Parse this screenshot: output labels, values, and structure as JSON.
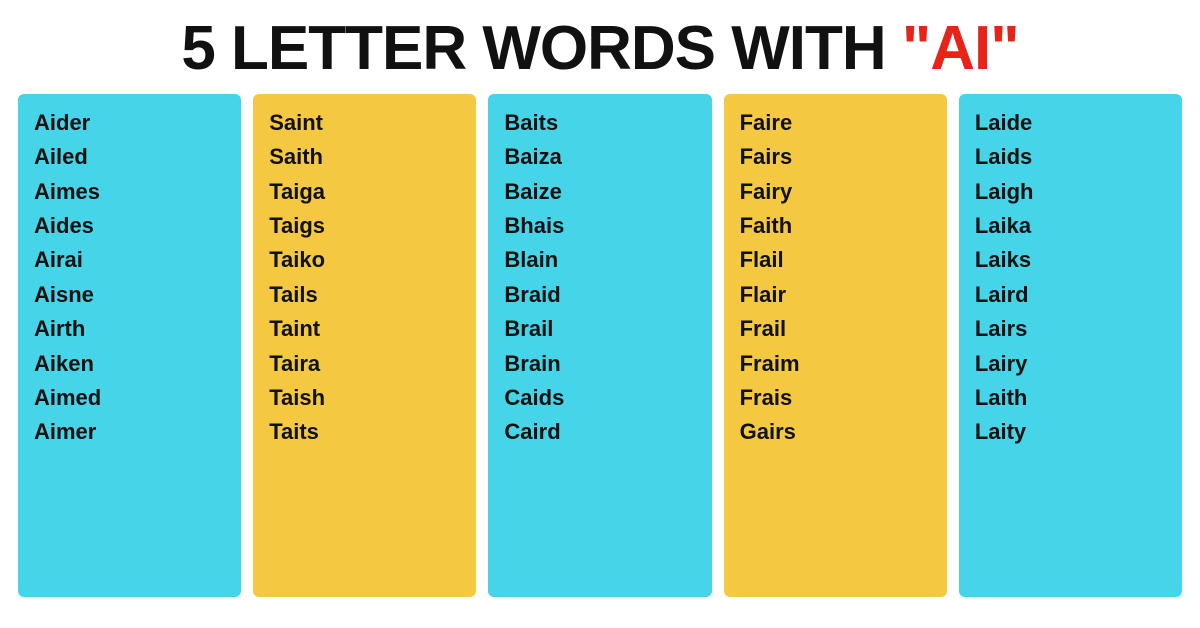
{
  "header": {
    "title_black": "5 LETTER WORDS WITH ",
    "title_red": "\"AI\""
  },
  "colors": {
    "cyan": "#45d4e8",
    "yellow": "#f5c842",
    "red": "#e8231a"
  },
  "columns": [
    {
      "id": "col1",
      "color": "cyan",
      "words": [
        "Aider",
        "Ailed",
        "Aimes",
        "Aides",
        "Airai",
        "Aisne",
        "Airth",
        "Aiken",
        "Aimed",
        "Aimer"
      ]
    },
    {
      "id": "col2",
      "color": "yellow",
      "words": [
        "Saint",
        "Saith",
        "Taiga",
        "Taigs",
        "Taiko",
        "Tails",
        "Taint",
        "Taira",
        "Taish",
        "Taits"
      ]
    },
    {
      "id": "col3",
      "color": "cyan",
      "words": [
        "Baits",
        "Baiza",
        "Baize",
        "Bhais",
        "Blain",
        "Braid",
        "Brail",
        "Brain",
        "Caids",
        "Caird"
      ]
    },
    {
      "id": "col4",
      "color": "yellow",
      "words": [
        "Faire",
        "Fairs",
        "Fairy",
        "Faith",
        "Flail",
        "Flair",
        "Frail",
        "Fraim",
        "Frais",
        "Gairs"
      ]
    },
    {
      "id": "col5",
      "color": "cyan",
      "words": [
        "Laide",
        "Laids",
        "Laigh",
        "Laika",
        "Laiks",
        "Laird",
        "Lairs",
        "Lairy",
        "Laith",
        "Laity"
      ]
    }
  ]
}
